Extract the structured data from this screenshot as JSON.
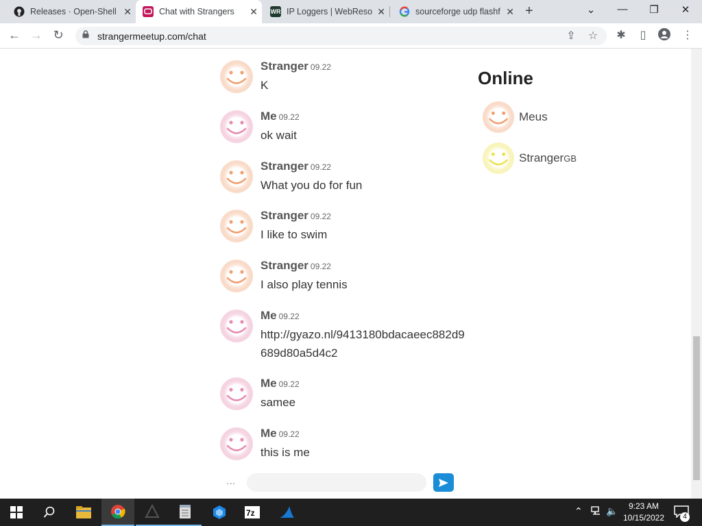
{
  "browser": {
    "tabs": [
      {
        "title": "Releases · Open-Shell/O",
        "icon": "github-icon"
      },
      {
        "title": "Chat with Strangers",
        "icon": "chat-icon",
        "active": true
      },
      {
        "title": "IP Loggers | WebResol",
        "icon": "webresolver-icon"
      },
      {
        "title": "sourceforge udp flashf",
        "icon": "google-icon"
      }
    ],
    "url": "strangermeetup.com/chat"
  },
  "chat": {
    "messages": [
      {
        "sender": "Stranger",
        "time": "09.22",
        "text": "K",
        "avatar": "orange"
      },
      {
        "sender": "Me",
        "time": "09.22",
        "text": "ok wait",
        "avatar": "pink"
      },
      {
        "sender": "Stranger",
        "time": "09.22",
        "text": "What you do for fun",
        "avatar": "orange"
      },
      {
        "sender": "Stranger",
        "time": "09.22",
        "text": "I like to swim",
        "avatar": "orange"
      },
      {
        "sender": "Stranger",
        "time": "09.22",
        "text": "I also play tennis",
        "avatar": "orange"
      },
      {
        "sender": "Me",
        "time": "09.22",
        "text": "http://gyazo.nl/9413180bdacaeec882d9689d80a5d4c2",
        "avatar": "pink"
      },
      {
        "sender": "Me",
        "time": "09.22",
        "text": "samee",
        "avatar": "pink"
      },
      {
        "sender": "Me",
        "time": "09.22",
        "text": "this is me",
        "avatar": "pink"
      }
    ],
    "compose": {
      "dots": "...",
      "placeholder": ""
    }
  },
  "online": {
    "title": "Online",
    "users": [
      {
        "name": "Meus",
        "suffix": "",
        "avatar": "orange"
      },
      {
        "name": "Stranger",
        "suffix": "GB",
        "avatar": "yellow"
      }
    ]
  },
  "taskbar": {
    "time": "9:23 AM",
    "date": "10/15/2022",
    "notification_count": "4"
  },
  "colors": {
    "avatar_orange": "#f0a070",
    "avatar_pink": "#e58cb0",
    "avatar_yellow": "#ece24a",
    "send_button": "#1a8cd8"
  }
}
